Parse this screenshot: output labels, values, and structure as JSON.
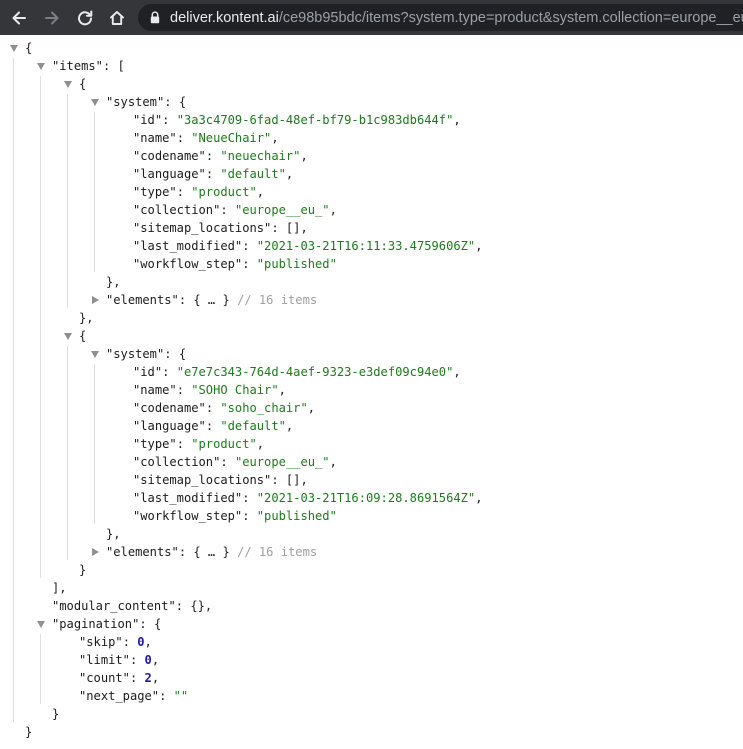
{
  "browser": {
    "url_host": "deliver.kontent.ai",
    "url_path": "/ce98b95bdc/items?system.type=product&system.collection=europe__eu_"
  },
  "json_lines": [
    {
      "level": 0,
      "toggle": "down",
      "key": null,
      "value": "{",
      "vtype": "p",
      "comma": false
    },
    {
      "level": 1,
      "toggle": "down",
      "key": "\"items\"",
      "value": "[",
      "vtype": "p",
      "comma": false
    },
    {
      "level": 2,
      "toggle": "down",
      "key": null,
      "value": "{",
      "vtype": "p",
      "comma": false
    },
    {
      "level": 3,
      "toggle": "down",
      "key": "\"system\"",
      "value": "{",
      "vtype": "p",
      "comma": false
    },
    {
      "level": 4,
      "key": "\"id\"",
      "value": "\"3a3c4709-6fad-48ef-bf79-b1c983db644f\"",
      "vtype": "s",
      "comma": true
    },
    {
      "level": 4,
      "key": "\"name\"",
      "value": "\"NeueChair\"",
      "vtype": "s",
      "comma": true
    },
    {
      "level": 4,
      "key": "\"codename\"",
      "value": "\"neuechair\"",
      "vtype": "s",
      "comma": true
    },
    {
      "level": 4,
      "key": "\"language\"",
      "value": "\"default\"",
      "vtype": "s",
      "comma": true
    },
    {
      "level": 4,
      "key": "\"type\"",
      "value": "\"product\"",
      "vtype": "s",
      "comma": true
    },
    {
      "level": 4,
      "key": "\"collection\"",
      "value": "\"europe__eu_\"",
      "vtype": "s",
      "comma": true
    },
    {
      "level": 4,
      "key": "\"sitemap_locations\"",
      "value": "[]",
      "vtype": "p",
      "comma": true
    },
    {
      "level": 4,
      "key": "\"last_modified\"",
      "value": "\"2021-03-21T16:11:33.4759606Z\"",
      "vtype": "s",
      "comma": true
    },
    {
      "level": 4,
      "key": "\"workflow_step\"",
      "value": "\"published\"",
      "vtype": "s",
      "comma": false
    },
    {
      "level": 3,
      "key": null,
      "value": "}",
      "vtype": "p",
      "comma": true
    },
    {
      "level": 3,
      "toggle": "right",
      "key": "\"elements\"",
      "value": "{ … }",
      "vtype": "p",
      "comma": false,
      "comment": "// 16 items"
    },
    {
      "level": 2,
      "key": null,
      "value": "}",
      "vtype": "p",
      "comma": true
    },
    {
      "level": 2,
      "toggle": "down",
      "key": null,
      "value": "{",
      "vtype": "p",
      "comma": false
    },
    {
      "level": 3,
      "toggle": "down",
      "key": "\"system\"",
      "value": "{",
      "vtype": "p",
      "comma": false
    },
    {
      "level": 4,
      "key": "\"id\"",
      "value": "\"e7e7c343-764d-4aef-9323-e3def09c94e0\"",
      "vtype": "s",
      "comma": true
    },
    {
      "level": 4,
      "key": "\"name\"",
      "value": "\"SOHO Chair\"",
      "vtype": "s",
      "comma": true
    },
    {
      "level": 4,
      "key": "\"codename\"",
      "value": "\"soho_chair\"",
      "vtype": "s",
      "comma": true
    },
    {
      "level": 4,
      "key": "\"language\"",
      "value": "\"default\"",
      "vtype": "s",
      "comma": true
    },
    {
      "level": 4,
      "key": "\"type\"",
      "value": "\"product\"",
      "vtype": "s",
      "comma": true
    },
    {
      "level": 4,
      "key": "\"collection\"",
      "value": "\"europe__eu_\"",
      "vtype": "s",
      "comma": true
    },
    {
      "level": 4,
      "key": "\"sitemap_locations\"",
      "value": "[]",
      "vtype": "p",
      "comma": true
    },
    {
      "level": 4,
      "key": "\"last_modified\"",
      "value": "\"2021-03-21T16:09:28.8691564Z\"",
      "vtype": "s",
      "comma": true
    },
    {
      "level": 4,
      "key": "\"workflow_step\"",
      "value": "\"published\"",
      "vtype": "s",
      "comma": false
    },
    {
      "level": 3,
      "key": null,
      "value": "}",
      "vtype": "p",
      "comma": true
    },
    {
      "level": 3,
      "toggle": "right",
      "key": "\"elements\"",
      "value": "{ … }",
      "vtype": "p",
      "comma": false,
      "comment": "// 16 items"
    },
    {
      "level": 2,
      "key": null,
      "value": "}",
      "vtype": "p",
      "comma": false
    },
    {
      "level": 1,
      "key": null,
      "value": "]",
      "vtype": "p",
      "comma": true
    },
    {
      "level": 1,
      "key": "\"modular_content\"",
      "value": "{}",
      "vtype": "p",
      "comma": true
    },
    {
      "level": 1,
      "toggle": "down",
      "key": "\"pagination\"",
      "value": "{",
      "vtype": "p",
      "comma": false
    },
    {
      "level": 2,
      "key": "\"skip\"",
      "value": "0",
      "vtype": "n",
      "comma": true
    },
    {
      "level": 2,
      "key": "\"limit\"",
      "value": "0",
      "vtype": "n",
      "comma": true
    },
    {
      "level": 2,
      "key": "\"count\"",
      "value": "2",
      "vtype": "n",
      "comma": true
    },
    {
      "level": 2,
      "key": "\"next_page\"",
      "value": "\"\"",
      "vtype": "s",
      "comma": false
    },
    {
      "level": 1,
      "key": null,
      "value": "}",
      "vtype": "p",
      "comma": false
    },
    {
      "level": 0,
      "key": null,
      "value": "}",
      "vtype": "p",
      "comma": false
    }
  ]
}
